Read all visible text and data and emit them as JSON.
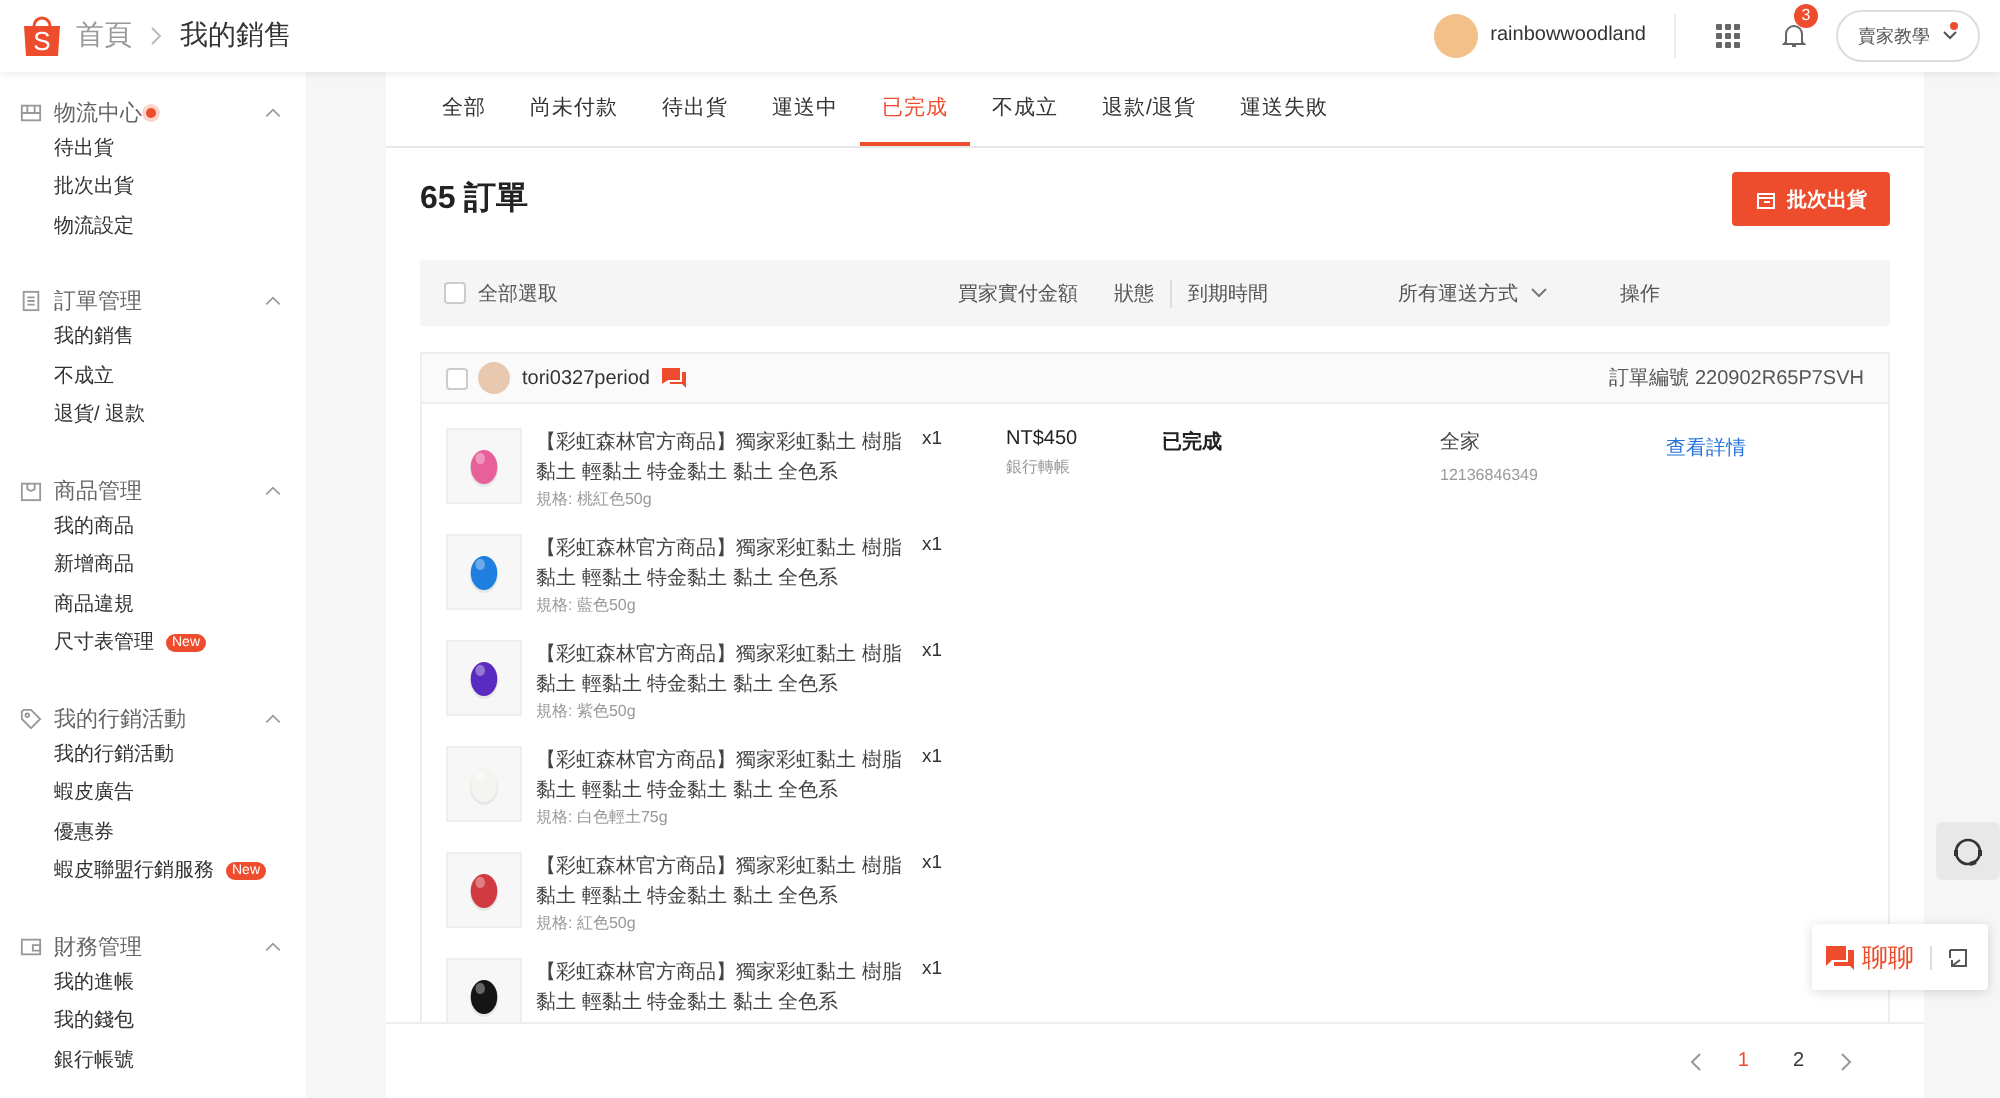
{
  "header": {
    "logo_text": "S",
    "breadcrumb": [
      {
        "label": "首頁"
      },
      {
        "label": "我的銷售"
      }
    ],
    "username": "rainbowwoodland",
    "notification_count": "3",
    "help_label": "賣家教學"
  },
  "sidebar": {
    "sections": [
      {
        "title": "物流中心",
        "dot": true,
        "expanded": true,
        "items": [
          {
            "label": "待出貨"
          },
          {
            "label": "批次出貨"
          },
          {
            "label": "物流設定"
          }
        ]
      },
      {
        "title": "訂單管理",
        "dot": false,
        "expanded": true,
        "items": [
          {
            "label": "我的銷售"
          },
          {
            "label": "不成立"
          },
          {
            "label": "退貨/ 退款"
          }
        ]
      },
      {
        "title": "商品管理",
        "dot": false,
        "expanded": true,
        "items": [
          {
            "label": "我的商品"
          },
          {
            "label": "新增商品"
          },
          {
            "label": "商品違規"
          },
          {
            "label": "尺寸表管理",
            "badge": "New"
          }
        ]
      },
      {
        "title": "我的行銷活動",
        "dot": false,
        "expanded": true,
        "items": [
          {
            "label": "我的行銷活動"
          },
          {
            "label": "蝦皮廣告"
          },
          {
            "label": "優惠券"
          },
          {
            "label": "蝦皮聯盟行銷服務",
            "badge": "New"
          }
        ]
      },
      {
        "title": "財務管理",
        "dot": false,
        "expanded": true,
        "items": [
          {
            "label": "我的進帳"
          },
          {
            "label": "我的錢包"
          },
          {
            "label": "銀行帳號"
          }
        ]
      }
    ]
  },
  "tabs": [
    {
      "label": "全部",
      "selected": false
    },
    {
      "label": "尚未付款",
      "selected": false
    },
    {
      "label": "待出貨",
      "selected": false
    },
    {
      "label": "運送中",
      "selected": false
    },
    {
      "label": "已完成",
      "selected": true
    },
    {
      "label": "不成立",
      "selected": false
    },
    {
      "label": "退款/退貨",
      "selected": false
    },
    {
      "label": "運送失敗",
      "selected": false
    }
  ],
  "title": "65 訂單",
  "batch_button": "批次出貨",
  "table_header": {
    "select_all": "全部選取",
    "checked": false,
    "columns": [
      "買家實付金額",
      "狀態",
      "到期時間"
    ],
    "shipping_filter": "所有運送方式",
    "action": "操作"
  },
  "order": {
    "buyer": "tori0327period",
    "checked": false,
    "order_no": "訂單編號 220902R65P7SVH",
    "price": "NT$450",
    "payment": "銀行轉帳",
    "status": "已完成",
    "shipping": "全家",
    "tracking": "12136846349",
    "action": "查看詳情",
    "items": [
      {
        "title": "【彩虹森林官方商品】獨家彩虹黏土 樹脂黏土 輕黏土 特金黏土 黏土 全色系",
        "qty": "x1",
        "spec": "規格: 桃紅色50g",
        "color": "#e8609a"
      },
      {
        "title": "【彩虹森林官方商品】獨家彩虹黏土 樹脂黏土 輕黏土 特金黏土 黏土 全色系",
        "qty": "x1",
        "spec": "規格: 藍色50g",
        "color": "#1e7fe0"
      },
      {
        "title": "【彩虹森林官方商品】獨家彩虹黏土 樹脂黏土 輕黏土 特金黏土 黏土 全色系",
        "qty": "x1",
        "spec": "規格: 紫色50g",
        "color": "#5a2bc0"
      },
      {
        "title": "【彩虹森林官方商品】獨家彩虹黏土 樹脂黏土 輕黏土 特金黏土 黏土 全色系",
        "qty": "x1",
        "spec": "規格: 白色輕土75g",
        "color": "#f4f4f0"
      },
      {
        "title": "【彩虹森林官方商品】獨家彩虹黏土 樹脂黏土 輕黏土 特金黏土 黏土 全色系",
        "qty": "x1",
        "spec": "規格: 紅色50g",
        "color": "#d03a40"
      },
      {
        "title": "【彩虹森林官方商品】獨家彩虹黏土 樹脂黏土 輕黏土 特金黏土 黏土 全色系",
        "qty": "x1",
        "color": "#151515"
      }
    ]
  },
  "pagination": [
    {
      "label": "1",
      "selected": true
    },
    {
      "label": "2",
      "selected": false
    }
  ],
  "chat": {
    "label": "聊聊"
  }
}
